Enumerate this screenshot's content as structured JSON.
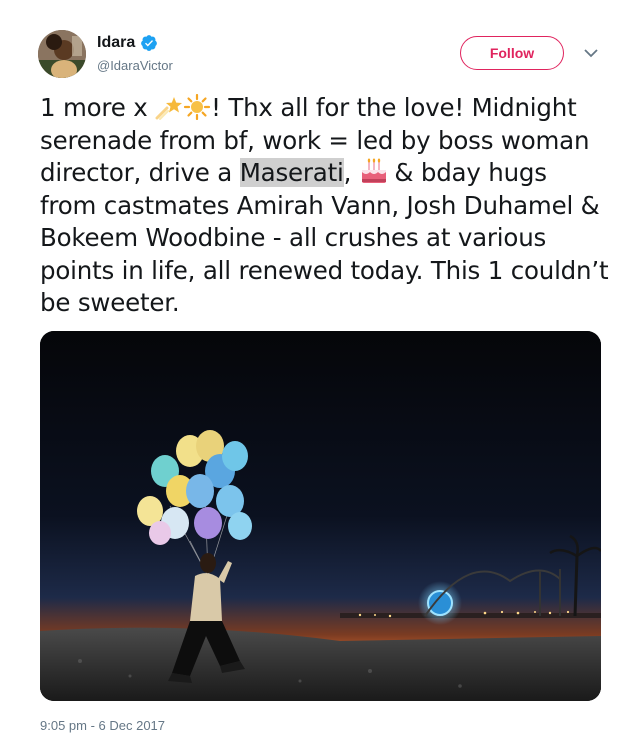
{
  "user": {
    "display_name": "Idara",
    "handle": "@IdaraVictor",
    "verified": true,
    "avatar_icon": "profile-photo"
  },
  "actions": {
    "follow_label": "Follow",
    "menu_icon": "chevron-down-icon"
  },
  "tweet": {
    "text_segments": [
      {
        "type": "text",
        "value": "1 more x "
      },
      {
        "type": "emoji",
        "name": "shooting-star-icon"
      },
      {
        "type": "emoji",
        "name": "sun-icon"
      },
      {
        "type": "text",
        "value": "! Thx all for the love! Midnight serenade from bf, work = led by boss woman director, drive a "
      },
      {
        "type": "highlight",
        "value": "Maserati"
      },
      {
        "type": "text",
        "value": ", "
      },
      {
        "type": "emoji",
        "name": "birthday-cake-icon"
      },
      {
        "type": "text",
        "value": " & bday hugs from castmates Amirah Vann, Josh Duhamel & Bokeem Woodbine - all crushes at various points in life, all renewed today. This 1 couldn’t be sweeter."
      }
    ],
    "timestamp": "9:05 pm - 6 Dec 2017"
  },
  "media": {
    "description_icon": "photo-night-balloons"
  },
  "colors": {
    "accent": "#e0245e",
    "verified_blue": "#1da1f2",
    "secondary_text": "#657786"
  }
}
